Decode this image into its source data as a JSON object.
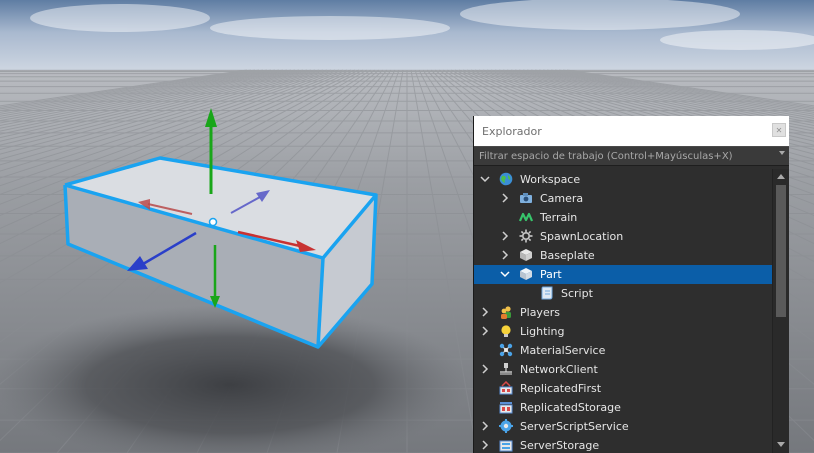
{
  "explorer": {
    "title": "Explorador",
    "filter_placeholder": "Filtrar espacio de trabajo (Control+Mayúsculas+X)",
    "items": [
      {
        "label": "Workspace",
        "icon": "globe-icon",
        "expanded": true
      },
      {
        "label": "Camera",
        "icon": "camera-icon",
        "expanded": false
      },
      {
        "label": "Terrain",
        "icon": "terrain-icon"
      },
      {
        "label": "SpawnLocation",
        "icon": "spawn-icon",
        "expanded": false
      },
      {
        "label": "Baseplate",
        "icon": "part-icon",
        "expanded": false
      },
      {
        "label": "Part",
        "icon": "part-icon",
        "expanded": true,
        "selected": true
      },
      {
        "label": "Script",
        "icon": "script-icon"
      },
      {
        "label": "Players",
        "icon": "players-icon",
        "expanded": false
      },
      {
        "label": "Lighting",
        "icon": "lightbulb-icon",
        "expanded": false
      },
      {
        "label": "MaterialService",
        "icon": "material-service-icon"
      },
      {
        "label": "NetworkClient",
        "icon": "network-client-icon",
        "expanded": false
      },
      {
        "label": "ReplicatedFirst",
        "icon": "replicated-first-icon"
      },
      {
        "label": "ReplicatedStorage",
        "icon": "replicated-storage-icon"
      },
      {
        "label": "ServerScriptService",
        "icon": "server-script-service-icon",
        "expanded": false
      },
      {
        "label": "ServerStorage",
        "icon": "server-storage-icon",
        "expanded": false
      }
    ]
  },
  "colors": {
    "selection": "#0b5ea8",
    "part_outline": "#1aa3f0",
    "axis_x": "#c83232",
    "axis_y": "#19a619",
    "axis_z": "#2a3fc9"
  }
}
